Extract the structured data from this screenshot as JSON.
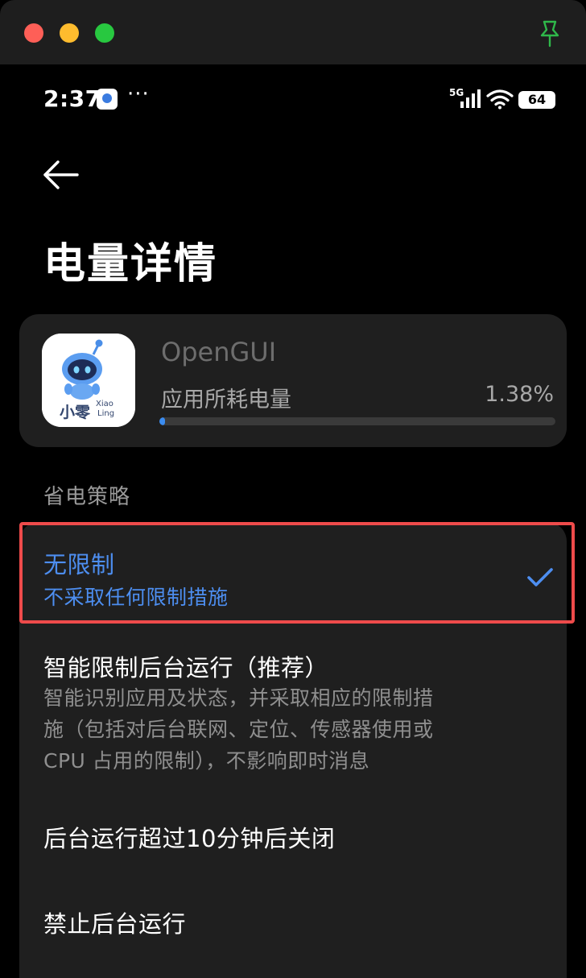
{
  "window": {
    "controls": [
      "close",
      "minimize",
      "zoom"
    ],
    "pin_icon": "pin-icon"
  },
  "status_bar": {
    "time": "2:37",
    "more": "···",
    "network": "5G",
    "battery_level": "64"
  },
  "header": {
    "back_icon": "arrow-left-icon",
    "title": "电量详情"
  },
  "app_card": {
    "app_name": "OpenGUI",
    "usage_label": "应用所耗电量",
    "usage_value": "1.38%",
    "usage_fraction": 0.0138,
    "icon_text_cn": "小零",
    "icon_text_en_1": "Xiao",
    "icon_text_en_2": "Ling"
  },
  "section": {
    "label": "省电策略"
  },
  "options": [
    {
      "title": "无限制",
      "description": "不采取任何限制措施",
      "selected": true
    },
    {
      "title": "智能限制后台运行（推荐）",
      "description_lines": [
        "智能识别应用及状态，并采取相应的限制措",
        "施（包括对后台联网、定位、传感器使用或",
        "CPU 占用的限制），不影响即时消息"
      ],
      "selected": false
    },
    {
      "title": "后台运行超过10分钟后关闭",
      "selected": false
    },
    {
      "title": "禁止后台运行",
      "selected": false
    }
  ],
  "colors": {
    "accent": "#4d8ef0",
    "highlight": "#ee4b4b",
    "card": "#1f1f1f",
    "background": "#000000"
  }
}
